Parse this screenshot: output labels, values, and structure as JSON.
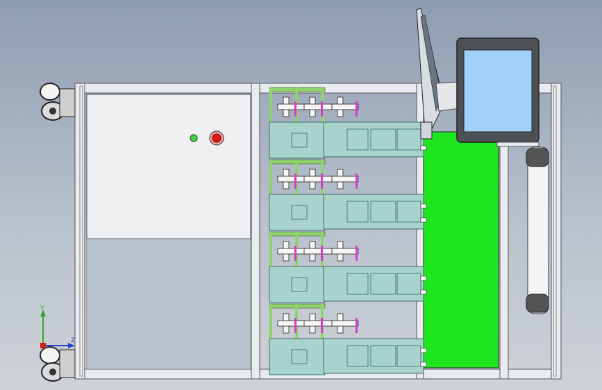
{
  "triad": {
    "y_label": "Y",
    "z_label": "Z"
  },
  "colors": {
    "background_top": "#8e9cb1",
    "frame": "#e9ecef",
    "panel": "#eef0f2",
    "green_panel": "#1ee61e",
    "pipe_green": "#8fd36b",
    "module": "#a7d3cc",
    "module_edge": "#3c6e66",
    "screen": "#9fd0f5",
    "indicator_green": "#3bd83b",
    "stop_red": "#e01818",
    "tube_magenta": "#d63cc8",
    "axis_y": "#2ea82e",
    "axis_z": "#2a3fd6"
  },
  "scene": {
    "module_stacks": 4,
    "icons": [
      "caster-wheel-icon",
      "emergency-stop-icon",
      "indicator-light-icon",
      "keyboard-icon",
      "monitor-icon",
      "handle-icon",
      "axis-triad-icon"
    ]
  }
}
